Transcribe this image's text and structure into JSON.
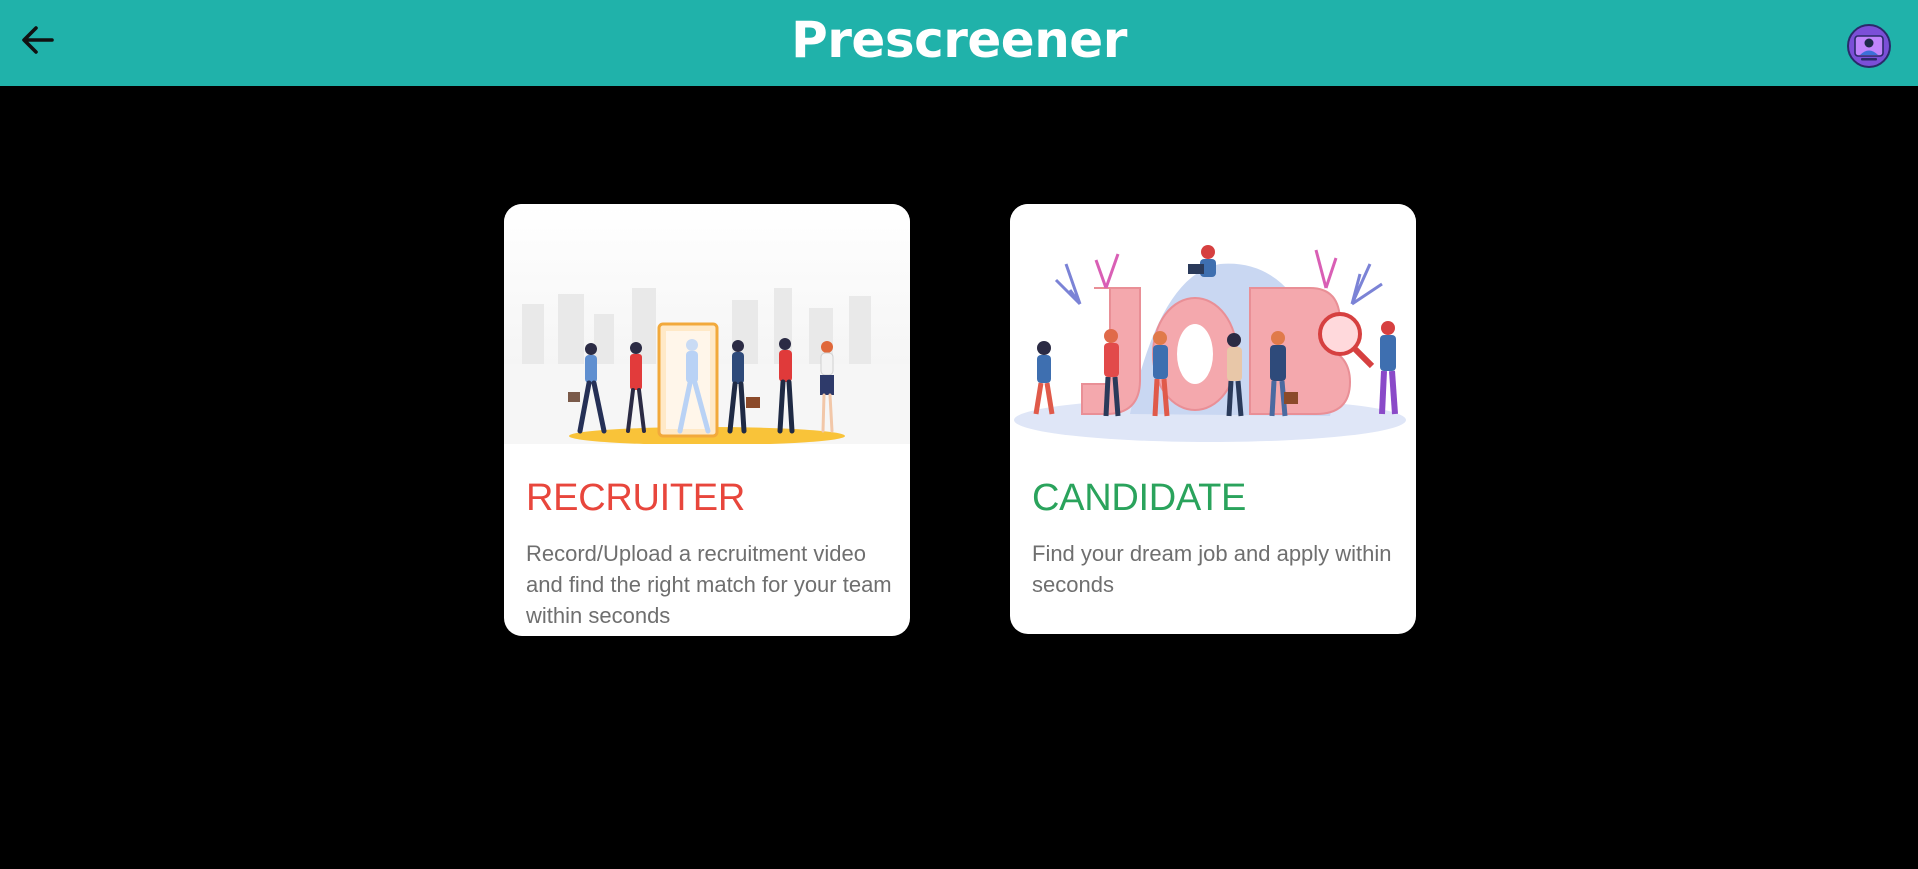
{
  "header": {
    "title": "Prescreener",
    "back_icon": "arrow-left-icon",
    "avatar_icon": "user-avatar-icon",
    "background_color": "#20b2aa"
  },
  "cards": [
    {
      "title": "RECRUITER",
      "description": "Record/Upload a recruitment video and find the right match for your team within seconds",
      "title_color": "#e8463c",
      "illustration": "recruitment-team-illustration"
    },
    {
      "title": "CANDIDATE",
      "description": "Find your dream job and apply within seconds",
      "title_color": "#2aa35c",
      "illustration": "job-search-illustration"
    }
  ]
}
